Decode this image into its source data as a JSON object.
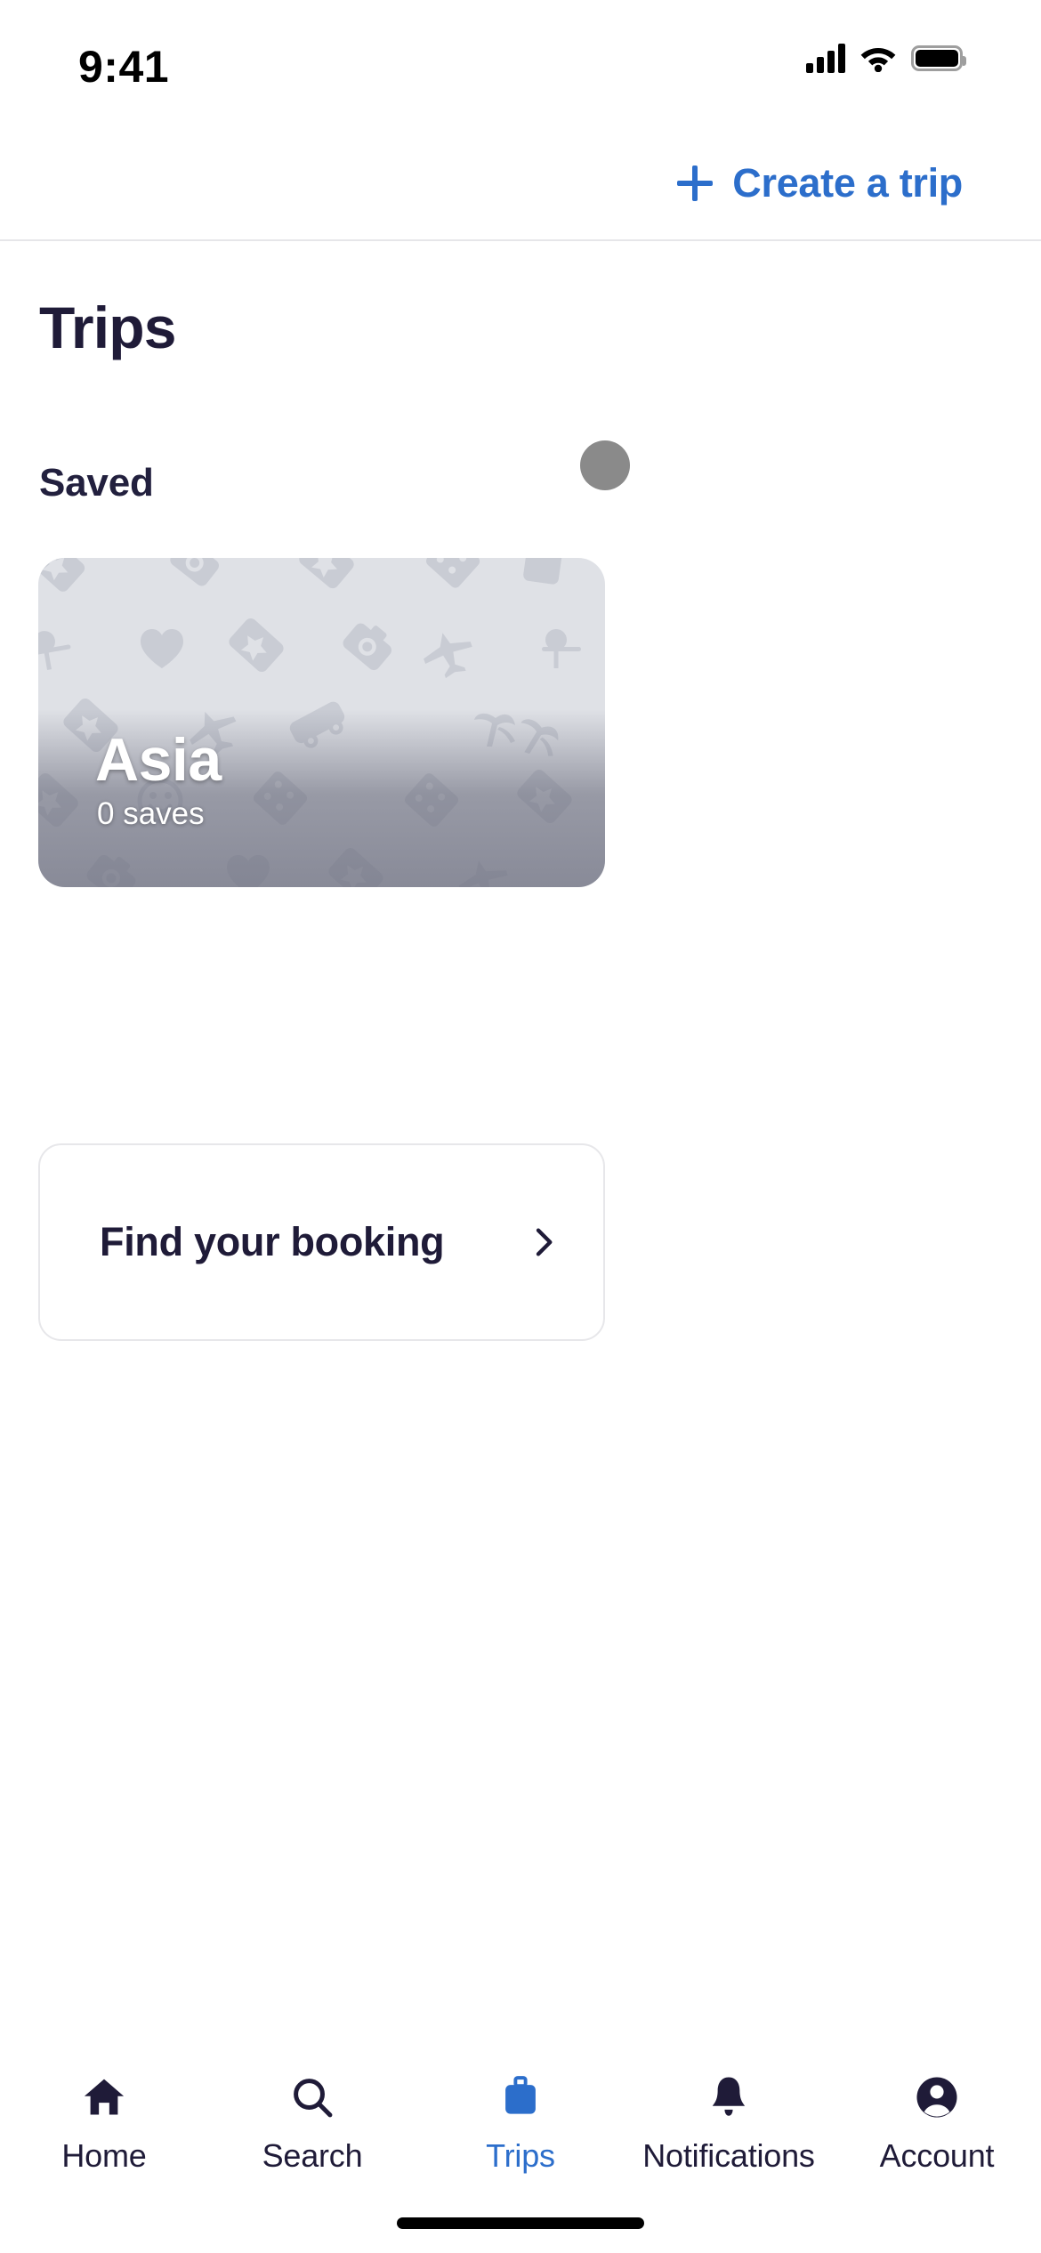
{
  "status_bar": {
    "time": "9:41",
    "signal_icon": "cellular-signal-icon",
    "wifi_icon": "wifi-icon",
    "battery_icon": "battery-icon"
  },
  "top_bar": {
    "create_trip_label": "Create a trip",
    "plus_icon": "plus-icon",
    "accent_color": "#2C6ECB"
  },
  "page": {
    "title": "Trips",
    "title_color": "#1F1B38"
  },
  "saved_section": {
    "title": "Saved",
    "cards": [
      {
        "name": "Asia",
        "saves_label": "0 saves",
        "background_color": "#dfe1e6",
        "avatar": "avatar-placeholder"
      }
    ]
  },
  "find_booking": {
    "label": "Find your booking",
    "chevron_icon": "chevron-right-icon"
  },
  "tab_bar": {
    "active_index": 2,
    "active_color": "#2C6ECB",
    "inactive_color": "#1F1B38",
    "items": [
      {
        "label": "Home",
        "icon": "home-icon"
      },
      {
        "label": "Search",
        "icon": "search-icon"
      },
      {
        "label": "Trips",
        "icon": "suitcase-icon"
      },
      {
        "label": "Notifications",
        "icon": "bell-icon"
      },
      {
        "label": "Account",
        "icon": "person-icon"
      }
    ]
  },
  "home_indicator": "home-indicator"
}
